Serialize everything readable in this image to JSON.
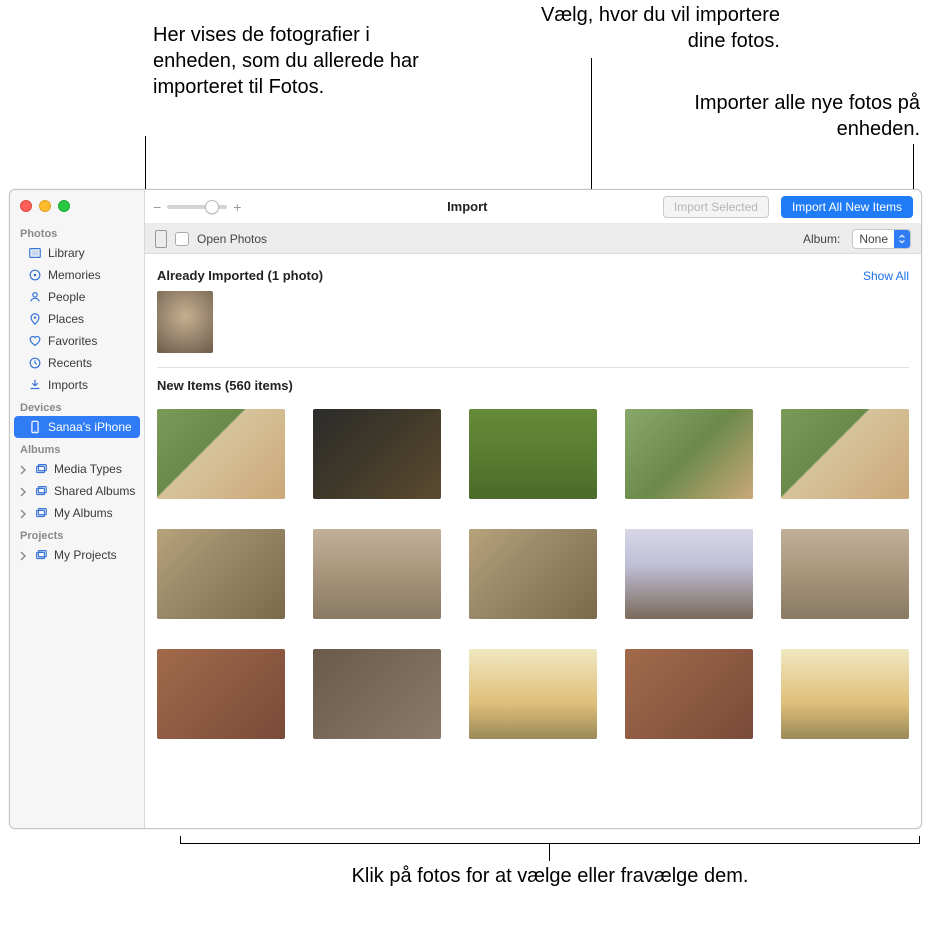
{
  "callouts": {
    "top_left": "Her vises de fotografier i enheden, som du allerede har importeret til Fotos.",
    "top_mid": "Vælg, hvor du vil importere dine fotos.",
    "top_right": "Importer alle nye fotos på enheden.",
    "bottom": "Klik på fotos for at vælge eller fravælge dem."
  },
  "toolbar": {
    "title": "Import",
    "import_selected": "Import Selected",
    "import_all": "Import All New Items"
  },
  "infobar": {
    "open_photos": "Open Photos",
    "album_label": "Album:",
    "album_value": "None"
  },
  "sections": {
    "already_label": "Already Imported (1 photo)",
    "show_all": "Show All",
    "new_label": "New Items (560 items)"
  },
  "sidebar": {
    "photos_title": "Photos",
    "devices_title": "Devices",
    "albums_title": "Albums",
    "projects_title": "Projects",
    "items": {
      "library": "Library",
      "memories": "Memories",
      "people": "People",
      "places": "Places",
      "favorites": "Favorites",
      "recents": "Recents",
      "imports": "Imports",
      "device": "Sanaa's iPhone",
      "media_types": "Media Types",
      "shared_albums": "Shared Albums",
      "my_albums": "My Albums",
      "my_projects": "My Projects"
    }
  }
}
